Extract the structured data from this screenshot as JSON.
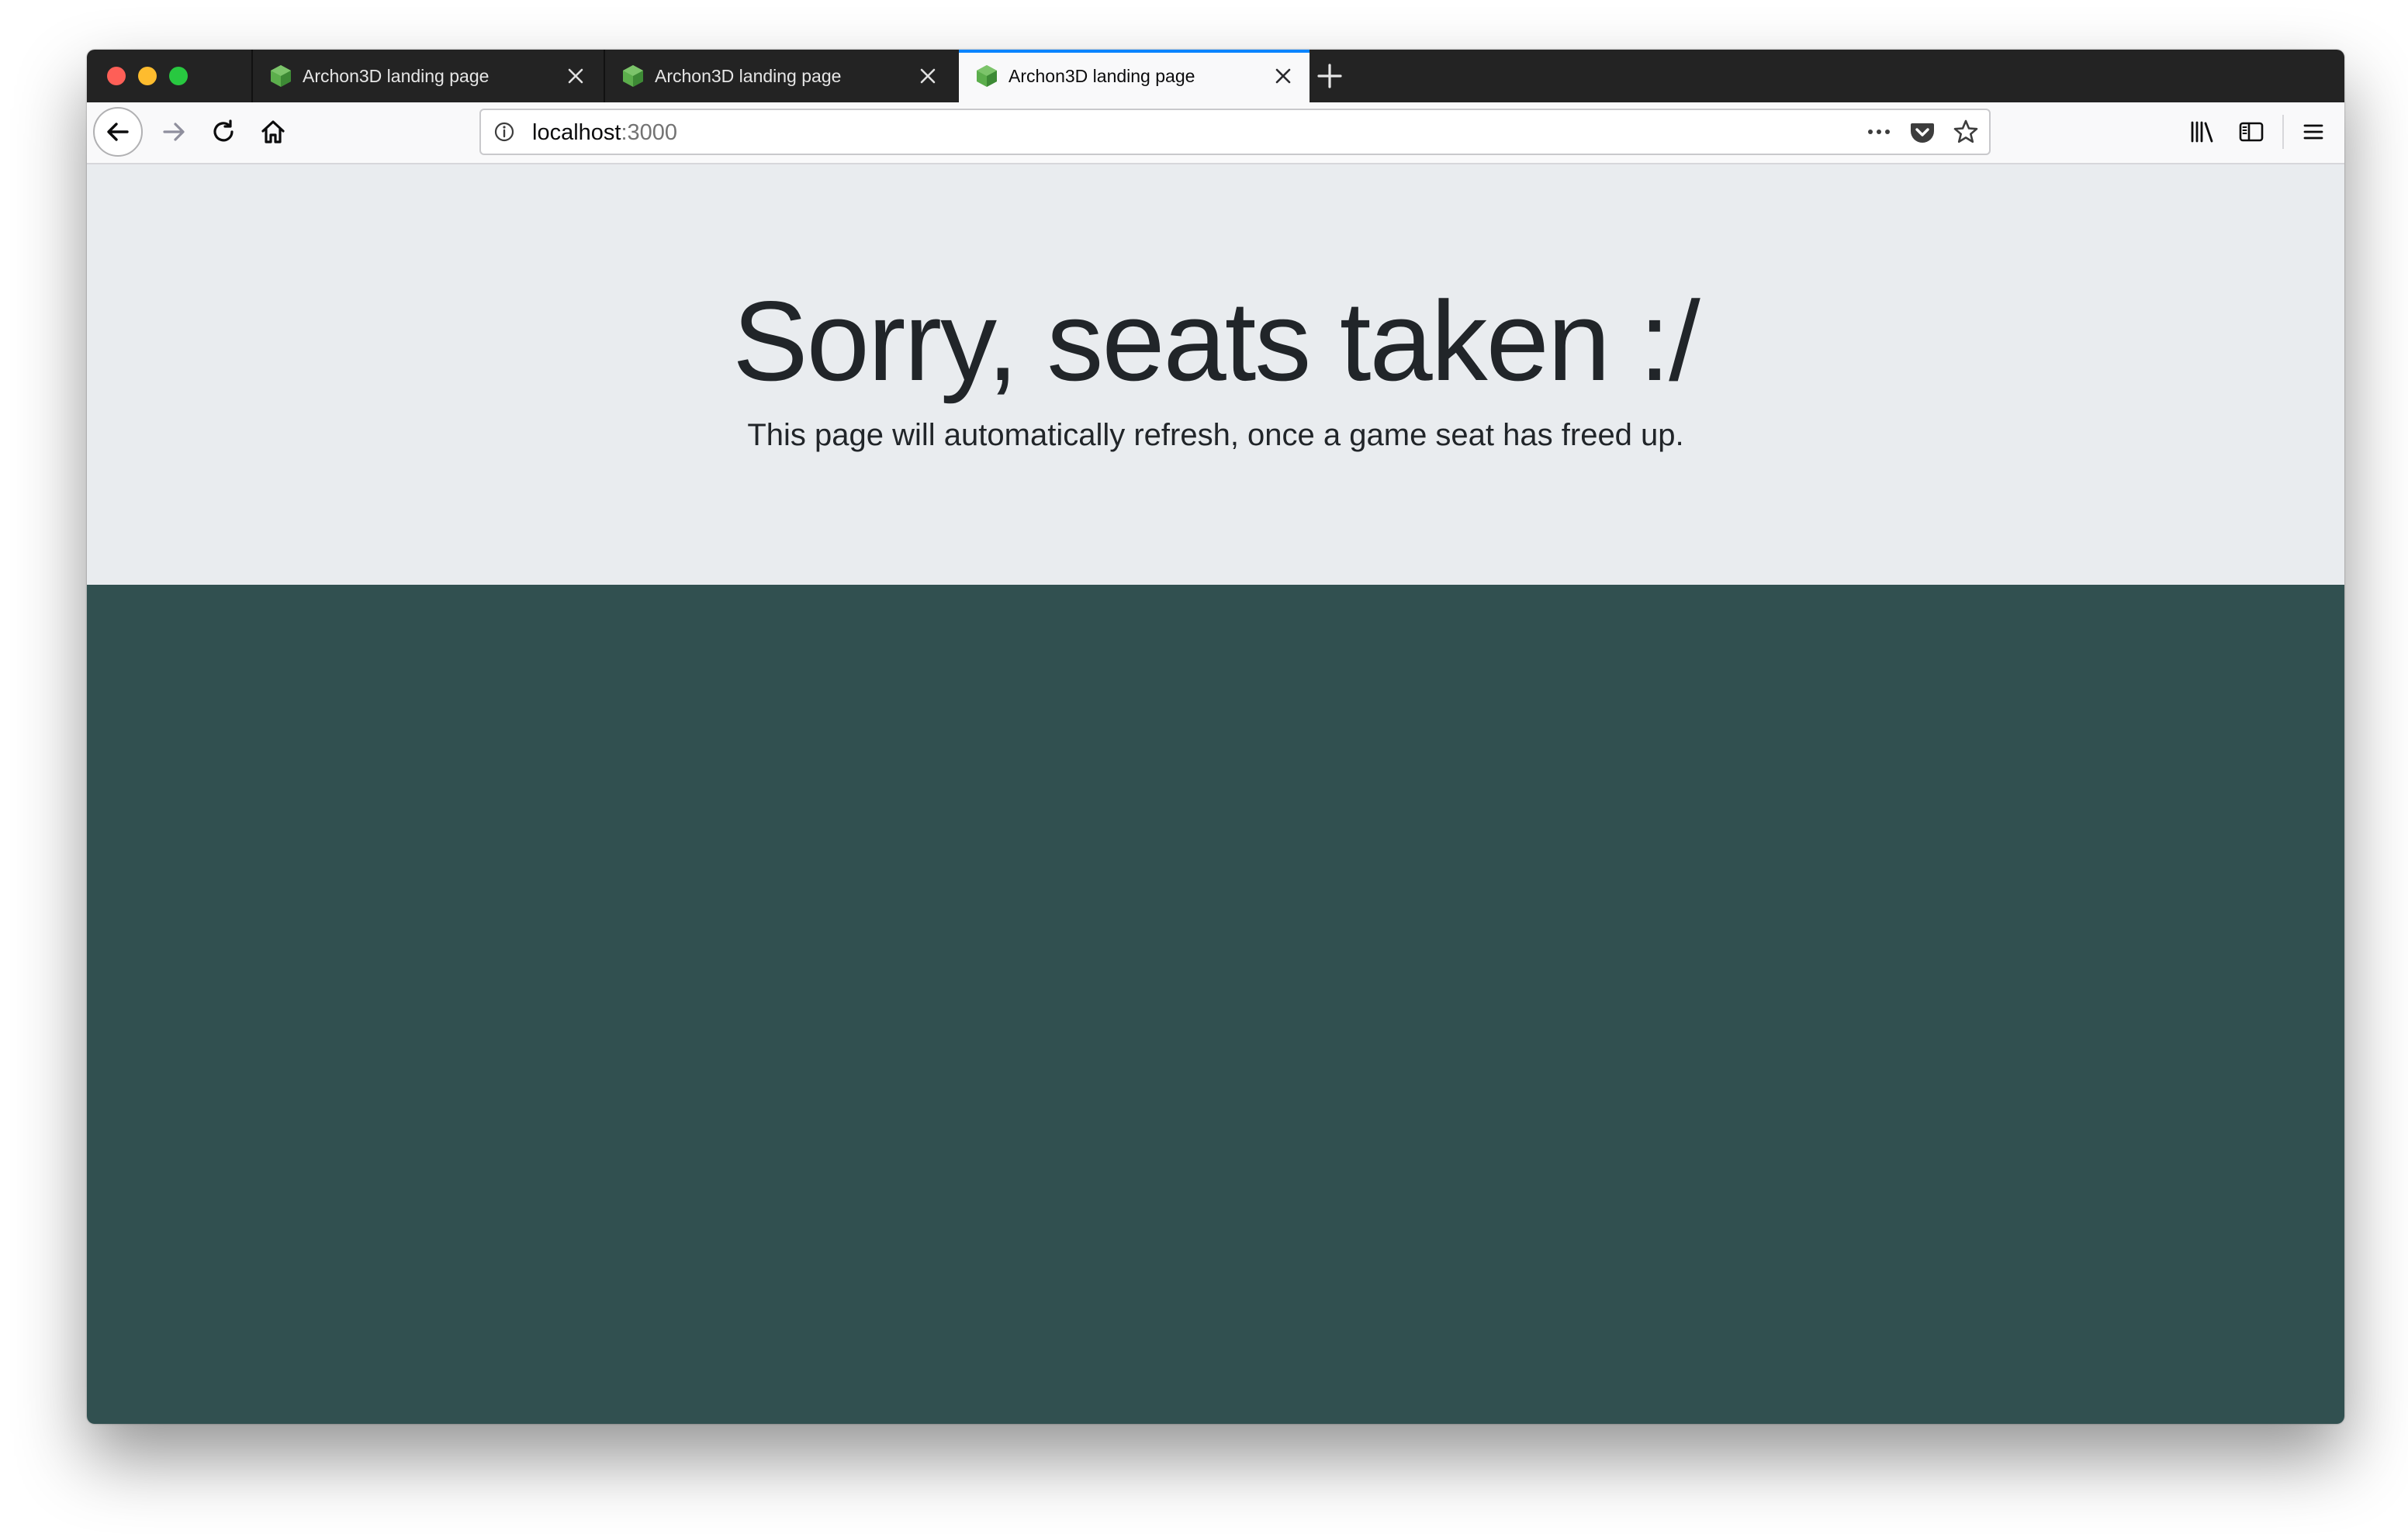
{
  "browser": {
    "tabs": [
      {
        "title": "Archon3D landing page",
        "active": false
      },
      {
        "title": "Archon3D landing page",
        "active": false
      },
      {
        "title": "Archon3D landing page",
        "active": true
      }
    ],
    "url": {
      "host": "localhost",
      "port": ":3000"
    },
    "icons": {
      "traffic_lights": [
        "close-window",
        "minimize-window",
        "zoom-window"
      ],
      "tab_favicon": "green-cube-icon",
      "tab_close": "close-icon",
      "new_tab": "plus-icon",
      "nav": [
        "back-arrow-icon",
        "forward-arrow-icon",
        "reload-icon",
        "home-icon"
      ],
      "urlbar": [
        "info-icon",
        "more-dots-icon",
        "pocket-icon",
        "bookmark-star-icon"
      ],
      "toolbar_right": [
        "library-icon",
        "sidebar-icon",
        "hamburger-menu-icon"
      ]
    }
  },
  "page": {
    "headline": "Sorry, seats taken :/",
    "subtext": "This page will automatically refresh, once a game seat has freed up."
  },
  "colors": {
    "tabstrip_bg": "#232323",
    "active_tab_accent": "#0a84ff",
    "jumbotron_bg": "#e9ecef",
    "game_area_bg": "#315050",
    "text": "#212529",
    "favicon_green": "#4caf50"
  }
}
